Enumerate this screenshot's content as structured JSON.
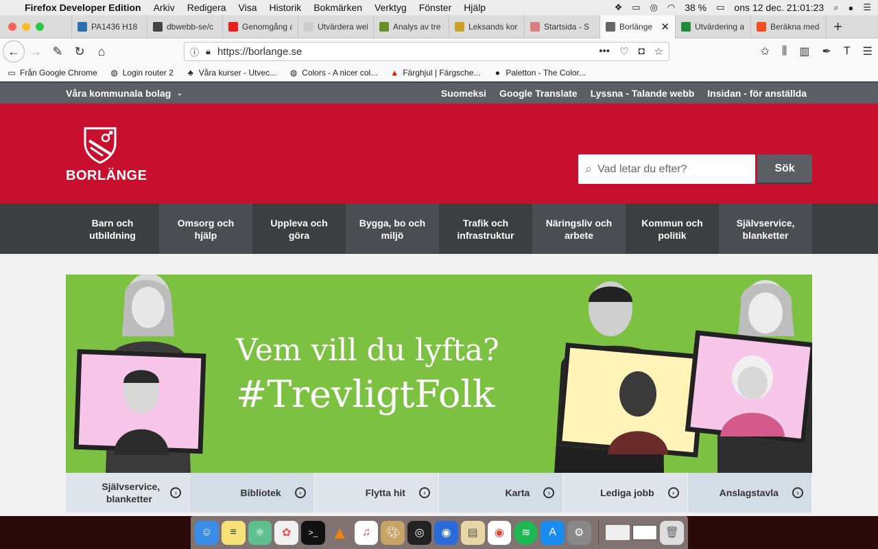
{
  "menubar": {
    "app_name": "Firefox Developer Edition",
    "items": [
      "Arkiv",
      "Redigera",
      "Visa",
      "Historik",
      "Bokmärken",
      "Verktyg",
      "Fönster",
      "Hjälp"
    ],
    "battery": "38 %",
    "datetime": "ons 12 dec.  21:01:23"
  },
  "tabs": [
    {
      "title": "PA1436 H18",
      "color": "#2a6fb2"
    },
    {
      "title": "dbwebb-se/c",
      "color": "#444444"
    },
    {
      "title": "Genomgång a",
      "color": "#e62117"
    },
    {
      "title": "Utvärdera webbp",
      "color": "#cccccc"
    },
    {
      "title": "Analys av tre",
      "color": "#6a8f2a"
    },
    {
      "title": "Leksands kor",
      "color": "#c9a227"
    },
    {
      "title": "Startsida - S",
      "color": "#d98080"
    },
    {
      "title": "Borlänge",
      "color": "#666666"
    },
    {
      "title": "Utvärdering a",
      "color": "#1e8e3e"
    },
    {
      "title": "Beräkna med",
      "color": "#f25022"
    }
  ],
  "active_tab_close": "✕",
  "new_tab": "+",
  "urlbar": {
    "url": "https://borlange.se"
  },
  "bookmarks": [
    "Från Google Chrome",
    "Login router 2",
    "Våra kurser - Utvec...",
    "Colors - A nicer col...",
    "Färghjul | Färgsche...",
    "Paletton - The Color..."
  ],
  "site": {
    "top_left": "Våra kommunala bolag",
    "top_links": [
      "Suomeksi",
      "Google Translate",
      "Lyssna - Talande webb",
      "Insidan - för anställda"
    ],
    "logo_name": "BORLÄNGE",
    "search_placeholder": "Vad letar du efter?",
    "search_button": "Sök",
    "nav": [
      "Barn och utbildning",
      "Omsorg och hjälp",
      "Uppleva och göra",
      "Bygga, bo och miljö",
      "Trafik och infrastruktur",
      "Näringsliv och arbete",
      "Kommun och politik",
      "Självservice, blanketter"
    ],
    "hero_line1": "Vem vill du lyfta?",
    "hero_line2": "#TrevligtFolk",
    "quick_links": [
      "Självservice, blanketter",
      "Bibliotek",
      "Flytta hit",
      "Karta",
      "Lediga jobb",
      "Anslagstavla"
    ]
  },
  "colors": {
    "brand_red": "#c8102e",
    "hero_green": "#7cc142",
    "nav_dark": "#3c3e42"
  }
}
